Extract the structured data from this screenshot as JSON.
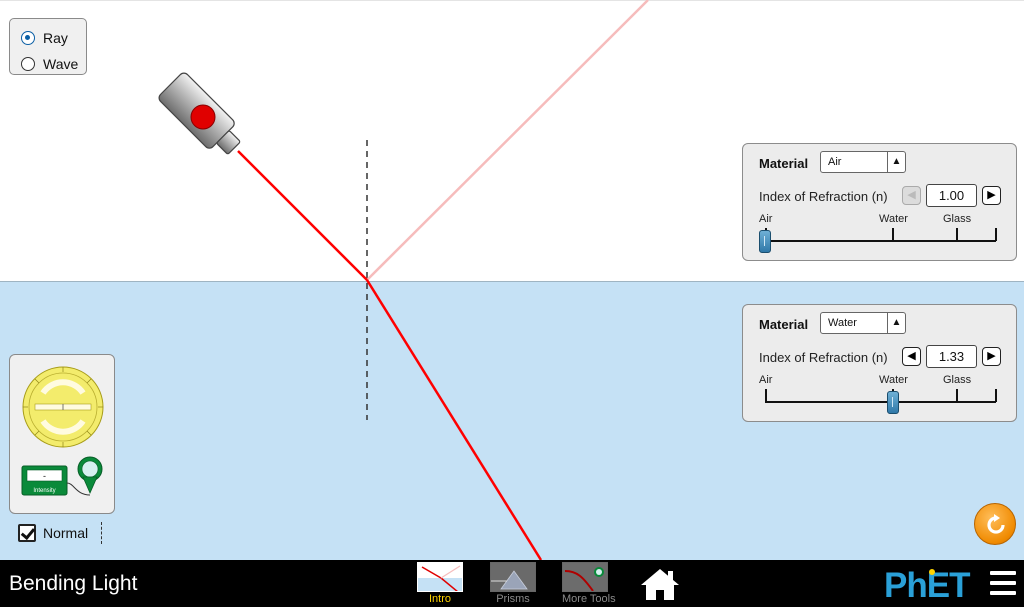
{
  "view_mode": {
    "options": [
      {
        "label": "Ray",
        "selected": true
      },
      {
        "label": "Wave",
        "selected": false
      }
    ]
  },
  "top_material": {
    "title": "Material",
    "selected": "Air",
    "ior_label": "Index of Refraction (n)",
    "ior_value": "1.00",
    "slider_labels": [
      "Air",
      "Water",
      "Glass"
    ],
    "decrement_enabled": false,
    "increment_enabled": true
  },
  "bottom_material": {
    "title": "Material",
    "selected": "Water",
    "ior_label": "Index of Refraction (n)",
    "ior_value": "1.33",
    "slider_labels": [
      "Air",
      "Water",
      "Glass"
    ],
    "decrement_enabled": true,
    "increment_enabled": true
  },
  "toolbox": {
    "protractor": "protractor-icon",
    "intensity_meter_label": "Intensity",
    "intensity_readout": "-"
  },
  "normal": {
    "label": "Normal",
    "checked": true
  },
  "laser": {
    "on": true,
    "beam_color": "#ff0000",
    "reflected_color": "#f6bcbc"
  },
  "colors": {
    "top_medium": "#ffffff",
    "bottom_medium": "#c5e1f5",
    "reset": "#f08a00",
    "active_tab": "#ffd400"
  },
  "navbar": {
    "title": "Bending Light",
    "screens": [
      {
        "label": "Intro",
        "active": true
      },
      {
        "label": "Prisms",
        "active": false
      },
      {
        "label": "More Tools",
        "active": false
      }
    ],
    "home": "home-icon",
    "brand": "PhET",
    "menu": "hamburger-menu-icon"
  }
}
